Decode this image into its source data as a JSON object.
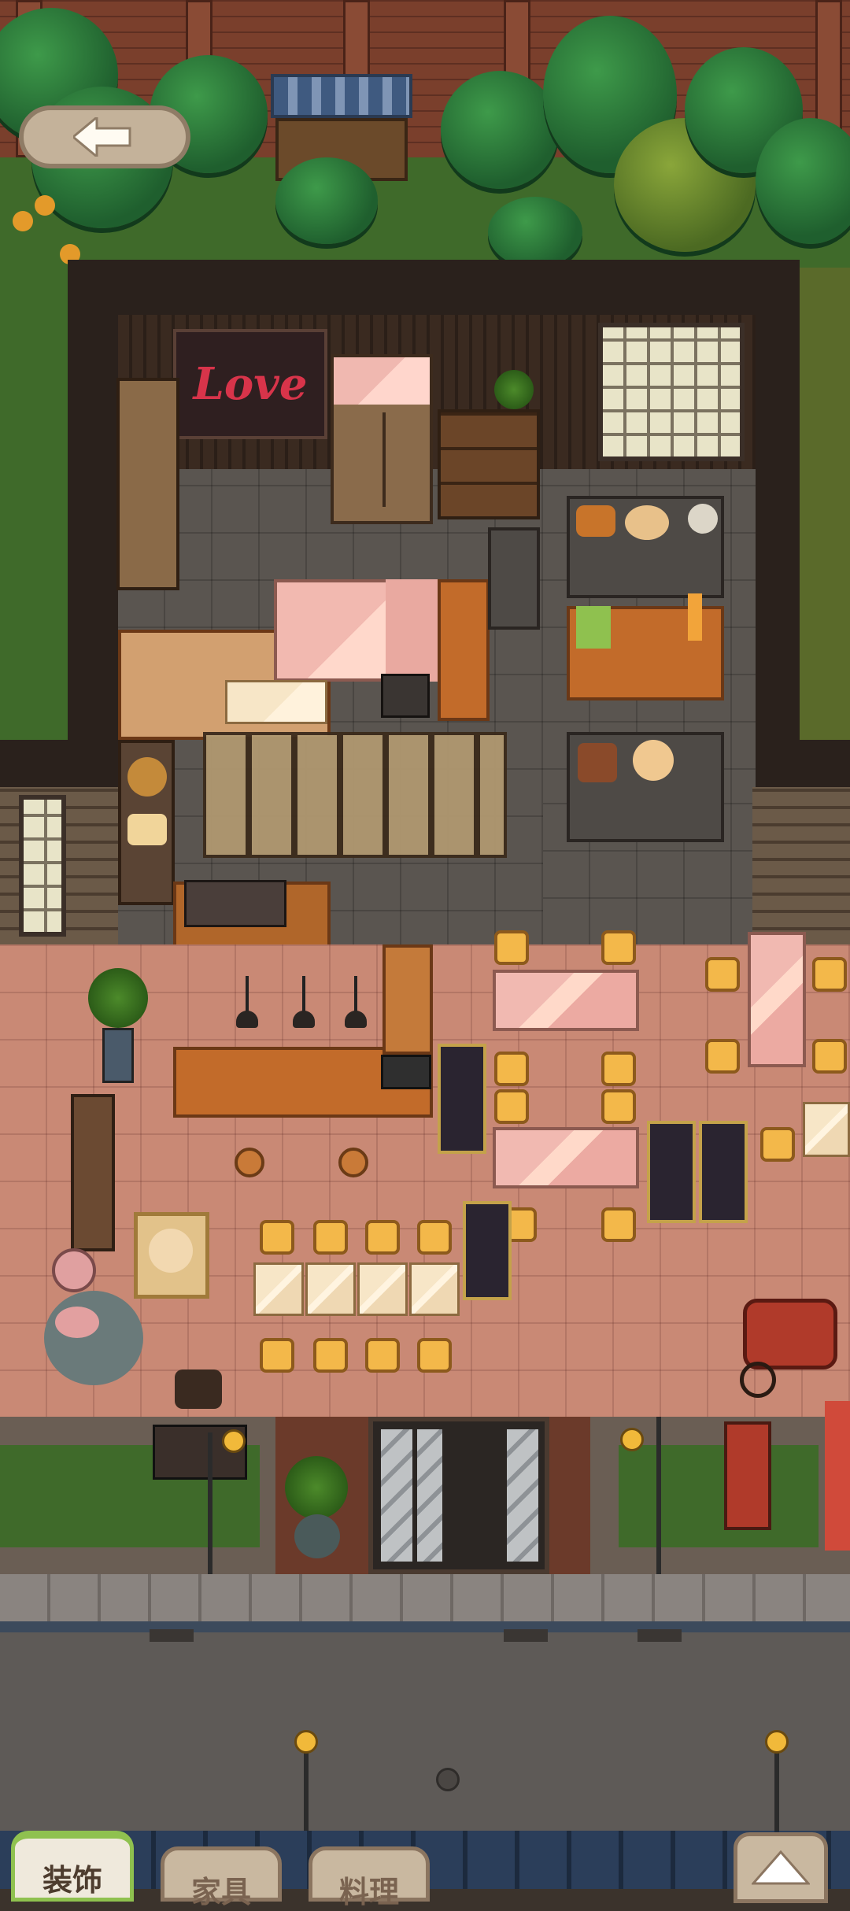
{
  "game": {
    "scene": "cafe-top-down",
    "sign_text": "Love"
  },
  "navigation": {
    "back_icon": "arrow-left-icon",
    "up_icon": "triangle-up-icon"
  },
  "bottom_tabs": [
    {
      "label": "装饰",
      "active": true
    },
    {
      "label": "家具",
      "active": false
    },
    {
      "label": "料理",
      "active": false
    }
  ],
  "colors": {
    "active_tab_accent": "#8fc14f",
    "tab_bg": "#c9b8a0",
    "back_button_bg": "#c4b29a"
  }
}
